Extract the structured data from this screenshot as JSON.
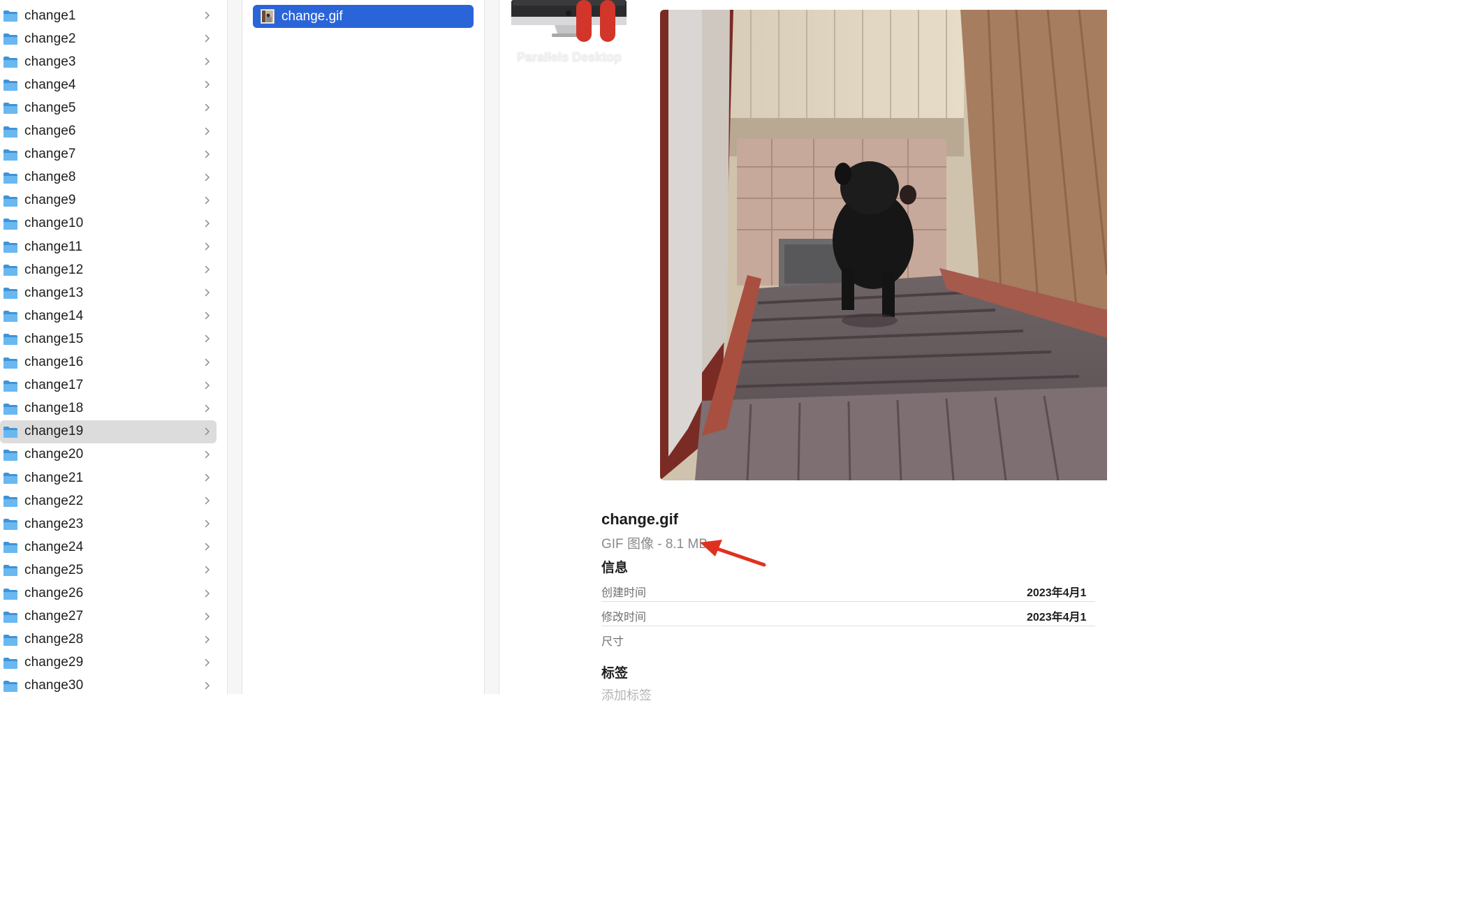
{
  "folders": [
    {
      "label": "change1"
    },
    {
      "label": "change2"
    },
    {
      "label": "change3"
    },
    {
      "label": "change4"
    },
    {
      "label": "change5"
    },
    {
      "label": "change6"
    },
    {
      "label": "change7"
    },
    {
      "label": "change8"
    },
    {
      "label": "change9"
    },
    {
      "label": "change10"
    },
    {
      "label": "change11"
    },
    {
      "label": "change12"
    },
    {
      "label": "change13"
    },
    {
      "label": "change14"
    },
    {
      "label": "change15"
    },
    {
      "label": "change16"
    },
    {
      "label": "change17"
    },
    {
      "label": "change18"
    },
    {
      "label": "change19"
    },
    {
      "label": "change20"
    },
    {
      "label": "change21"
    },
    {
      "label": "change22"
    },
    {
      "label": "change23"
    },
    {
      "label": "change24"
    },
    {
      "label": "change25"
    },
    {
      "label": "change26"
    },
    {
      "label": "change27"
    },
    {
      "label": "change28"
    },
    {
      "label": "change29"
    },
    {
      "label": "change30"
    }
  ],
  "selected_folder": "change19",
  "files": [
    {
      "label": "change.gif"
    }
  ],
  "app": {
    "name": "Parallels Desktop"
  },
  "preview": {
    "file_name": "change.gif",
    "file_meta": "GIF 图像 - 8.1 MB",
    "info_title": "信息",
    "created_label": "创建时间",
    "created_value": "2023年4月1",
    "modified_label": "修改时间",
    "modified_value": "2023年4月1",
    "size_label": "尺寸",
    "tags_title": "标签",
    "tags_placeholder": "添加标签"
  },
  "colors": {
    "selection_blue": "#2a64d9",
    "folder_blue": "#5fb2ef",
    "annotation_arrow": "#e0311f"
  }
}
